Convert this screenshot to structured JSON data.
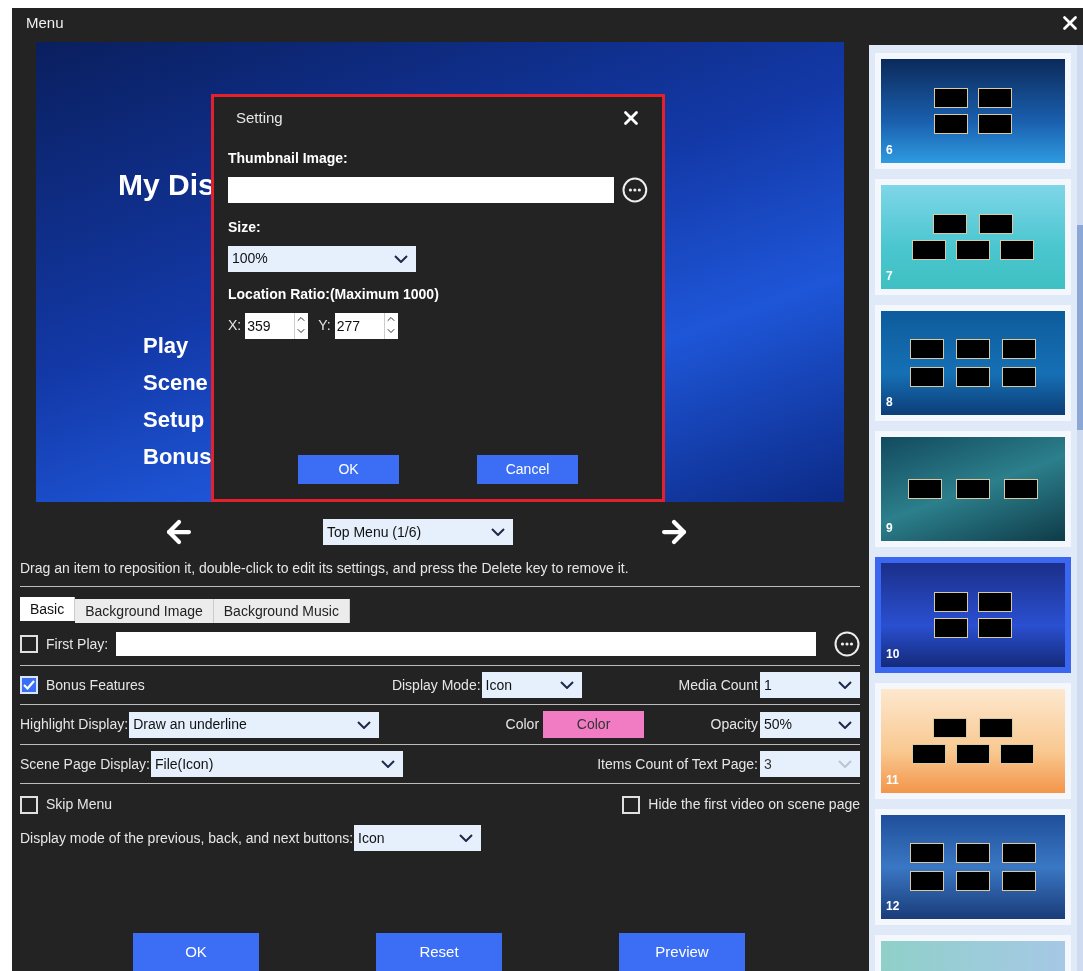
{
  "window": {
    "title": "Menu"
  },
  "preview": {
    "title": "My Dis",
    "items": [
      "Play",
      "Scene",
      "Setup",
      "Bonus"
    ]
  },
  "dialog": {
    "title": "Setting",
    "thumbnail_label": "Thumbnail Image:",
    "size_label": "Size:",
    "size_value": "100%",
    "location_label": "Location Ratio:(Maximum 1000)",
    "x_label": "X:",
    "x_value": "359",
    "y_label": "Y:",
    "y_value": "277",
    "buttons": [
      "OK",
      "Cancel"
    ]
  },
  "page_select": {
    "value": "Top Menu (1/6)"
  },
  "hint": "Drag an item to reposition it, double-click to edit its settings, and press the Delete key to remove it.",
  "tabs": [
    {
      "label": "Basic",
      "selected": true
    },
    {
      "label": "Background Image",
      "selected": false
    },
    {
      "label": "Background Music",
      "selected": false
    }
  ],
  "first_play": {
    "label": "First Play:",
    "checked": false
  },
  "bonus_features": {
    "label": "Bonus Features",
    "checked": true
  },
  "display_mode": {
    "label": "Display Mode:",
    "value": "Icon"
  },
  "media_count": {
    "label": "Media Count",
    "value": "1"
  },
  "highlight_display": {
    "label": "Highlight Display:",
    "value": "Draw an underline"
  },
  "color": {
    "label": "Color",
    "button": "Color",
    "color": "#f27cc3"
  },
  "opacity": {
    "label": "Opacity",
    "value": "50%"
  },
  "scene_page_display": {
    "label": "Scene Page Display:",
    "value": "File(Icon)"
  },
  "items_count": {
    "label": "Items Count of Text Page:",
    "value": "3",
    "disabled": true
  },
  "skip_menu": {
    "label": "Skip Menu",
    "checked": false
  },
  "hide_first_video": {
    "label": "Hide the first video on scene page",
    "checked": false
  },
  "nav_buttons_mode": {
    "label": "Display mode of the previous, back, and next buttons:",
    "value": "Icon"
  },
  "buttons": [
    "OK",
    "Reset",
    "Preview"
  ],
  "templates": [
    {
      "number": "6",
      "kind": "grid4",
      "selected": false
    },
    {
      "number": "7",
      "kind": "pyramid5",
      "selected": false
    },
    {
      "number": "8",
      "kind": "grid6",
      "selected": false
    },
    {
      "number": "9",
      "kind": "row3",
      "selected": false
    },
    {
      "number": "10",
      "kind": "grid4",
      "selected": true
    },
    {
      "number": "11",
      "kind": "pyramid5",
      "selected": false
    },
    {
      "number": "12",
      "kind": "grid6",
      "selected": false
    },
    {
      "kind": "blank",
      "selected": false
    }
  ]
}
